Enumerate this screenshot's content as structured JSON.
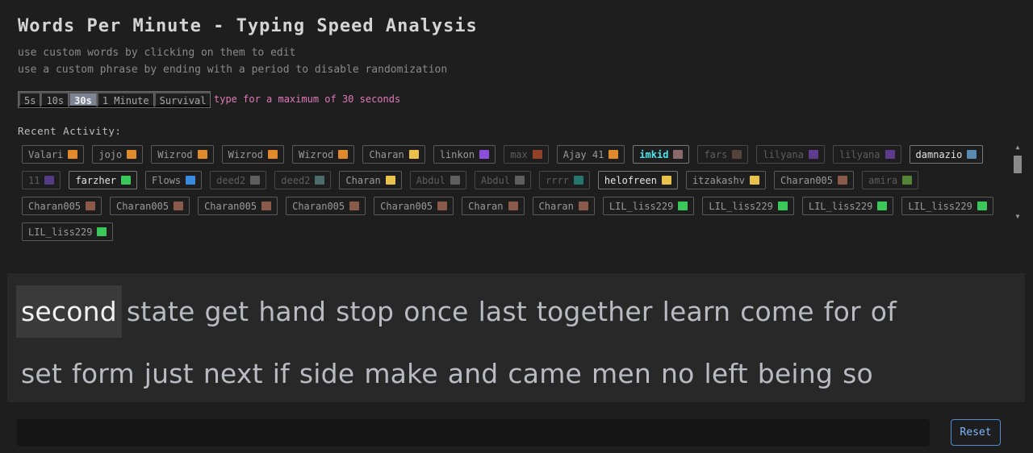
{
  "header": {
    "title": "Words Per Minute - Typing Speed Analysis",
    "hint1": "use custom words by clicking on them to edit",
    "hint2": "use a custom phrase by ending with a period to disable randomization"
  },
  "modes": {
    "options": [
      "5s",
      "10s",
      "30s",
      "1 Minute",
      "Survival"
    ],
    "active": "30s",
    "hint": "type for a maximum of 30 seconds",
    "hint_color": "#e279b9"
  },
  "recent": {
    "label": "Recent Activity:",
    "items": [
      {
        "name": "Valari",
        "icon": "crab-icon",
        "color": "#e08a2c",
        "tone": "normal"
      },
      {
        "name": "jojo",
        "icon": "crab-icon",
        "color": "#e08a2c",
        "tone": "normal"
      },
      {
        "name": "Wizrod",
        "icon": "crab-icon",
        "color": "#e08a2c",
        "tone": "normal"
      },
      {
        "name": "Wizrod",
        "icon": "crab-icon",
        "color": "#e08a2c",
        "tone": "normal"
      },
      {
        "name": "Wizrod",
        "icon": "crab-icon",
        "color": "#e08a2c",
        "tone": "normal"
      },
      {
        "name": "Charan",
        "icon": "hat-icon",
        "color": "#e8c24a",
        "tone": "normal"
      },
      {
        "name": "linkon",
        "icon": "monster-icon",
        "color": "#8a4fd8",
        "tone": "normal"
      },
      {
        "name": "max",
        "icon": "monster-icon",
        "color": "#e05a2c",
        "tone": "dim"
      },
      {
        "name": "Ajay 41",
        "icon": "star-icon",
        "color": "#e08a2c",
        "tone": "normal"
      },
      {
        "name": "imkid",
        "icon": "robot-icon",
        "color": "#8a6a6a",
        "tone": "cyan"
      },
      {
        "name": "fars",
        "icon": "hat-icon",
        "color": "#7a5a4a",
        "tone": "dim"
      },
      {
        "name": "lilyana",
        "icon": "mask-icon",
        "color": "#8a4fd8",
        "tone": "dim"
      },
      {
        "name": "lilyana",
        "icon": "mask-icon",
        "color": "#8a4fd8",
        "tone": "dim"
      },
      {
        "name": "damnazio",
        "icon": "robot-icon",
        "color": "#5a8ab0",
        "tone": "bright"
      },
      {
        "name": "11",
        "icon": "invader-icon",
        "color": "#7a4fc8",
        "tone": "dim"
      },
      {
        "name": "farzher",
        "icon": "ghost-icon",
        "color": "#3ac85a",
        "tone": "bright"
      },
      {
        "name": "Flows",
        "icon": "ghost-icon",
        "color": "#3a8ae0",
        "tone": "normal"
      },
      {
        "name": "deed2",
        "icon": "dots-icon",
        "color": "#888888",
        "tone": "dim"
      },
      {
        "name": "deed2",
        "icon": "dots-icon",
        "color": "#6aa0a0",
        "tone": "dim"
      },
      {
        "name": "Charan",
        "icon": "hat-icon",
        "color": "#e8c24a",
        "tone": "normal"
      },
      {
        "name": "Abdul",
        "icon": "skull-icon",
        "color": "#888888",
        "tone": "dim"
      },
      {
        "name": "Abdul",
        "icon": "skull-icon",
        "color": "#888888",
        "tone": "dim"
      },
      {
        "name": "rrrr",
        "icon": "invader-icon",
        "color": "#2ab0a0",
        "tone": "dim"
      },
      {
        "name": "helofreen",
        "icon": "crab-icon",
        "color": "#e8c24a",
        "tone": "bright"
      },
      {
        "name": "itzakashv",
        "icon": "crab-icon",
        "color": "#e8c24a",
        "tone": "normal"
      },
      {
        "name": "Charan005",
        "icon": "block-icon",
        "color": "#8a5a4a",
        "tone": "normal"
      },
      {
        "name": "amira",
        "icon": "tree-icon",
        "color": "#7ac84a",
        "tone": "dim"
      },
      {
        "name": "Charan005",
        "icon": "block-icon",
        "color": "#8a5a4a",
        "tone": "normal"
      },
      {
        "name": "Charan005",
        "icon": "block-icon",
        "color": "#8a5a4a",
        "tone": "normal"
      },
      {
        "name": "Charan005",
        "icon": "block-icon",
        "color": "#8a5a4a",
        "tone": "normal"
      },
      {
        "name": "Charan005",
        "icon": "block-icon",
        "color": "#8a5a4a",
        "tone": "normal"
      },
      {
        "name": "Charan005",
        "icon": "block-icon",
        "color": "#8a5a4a",
        "tone": "normal"
      },
      {
        "name": "Charan",
        "icon": "block-icon",
        "color": "#8a5a4a",
        "tone": "normal"
      },
      {
        "name": "Charan",
        "icon": "block-icon",
        "color": "#8a5a4a",
        "tone": "normal"
      },
      {
        "name": "LIL_liss229",
        "icon": "bug-icon",
        "color": "#3ac85a",
        "tone": "normal"
      },
      {
        "name": "LIL_liss229",
        "icon": "bug-icon",
        "color": "#3ac85a",
        "tone": "normal"
      },
      {
        "name": "LIL_liss229",
        "icon": "bug-icon",
        "color": "#3ac85a",
        "tone": "normal"
      },
      {
        "name": "LIL_liss229",
        "icon": "bug-icon",
        "color": "#3ac85a",
        "tone": "normal"
      },
      {
        "name": "LIL_liss229",
        "icon": "bug-icon",
        "color": "#3ac85a",
        "tone": "normal"
      }
    ]
  },
  "words": {
    "current": "second",
    "line1": [
      "state",
      "get",
      "hand",
      "stop",
      "once",
      "last",
      "together",
      "learn",
      "come",
      "for",
      "of"
    ],
    "line2": [
      "set",
      "form",
      "just",
      "next",
      "if",
      "side",
      "make",
      "and",
      "came",
      "men",
      "no",
      "left",
      "being",
      "so"
    ]
  },
  "input": {
    "value": "",
    "placeholder": ""
  },
  "reset": {
    "label": "Reset",
    "color": "#4c8fd6"
  }
}
